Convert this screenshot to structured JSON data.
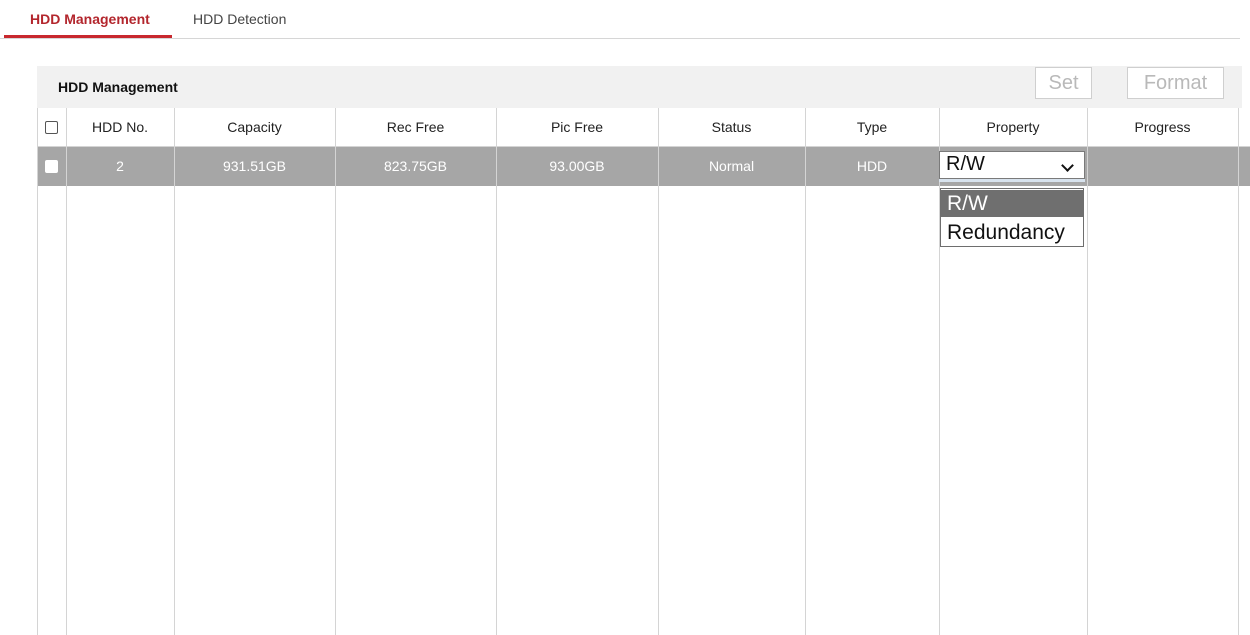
{
  "tabs": [
    {
      "label": "HDD Management",
      "active": true
    },
    {
      "label": "HDD Detection",
      "active": false
    }
  ],
  "panel": {
    "title": "HDD Management",
    "buttons": {
      "set": "Set",
      "format": "Format"
    }
  },
  "table": {
    "columns": [
      "HDD No.",
      "Capacity",
      "Rec Free",
      "Pic Free",
      "Status",
      "Type",
      "Property",
      "Progress"
    ],
    "rows": [
      {
        "hdd_no": "2",
        "capacity": "931.51GB",
        "rec_free": "823.75GB",
        "pic_free": "93.00GB",
        "status": "Normal",
        "type": "HDD",
        "property": "R/W",
        "progress": "",
        "selected": true
      }
    ]
  },
  "property_dropdown": {
    "selected": "R/W",
    "options": [
      "R/W",
      "Redundancy"
    ]
  },
  "colors": {
    "accent": "#c8282e",
    "selected_row": "#a6a6a6",
    "header_bg": "#f1f1f1",
    "highlight_option": "#6f6f6f"
  }
}
